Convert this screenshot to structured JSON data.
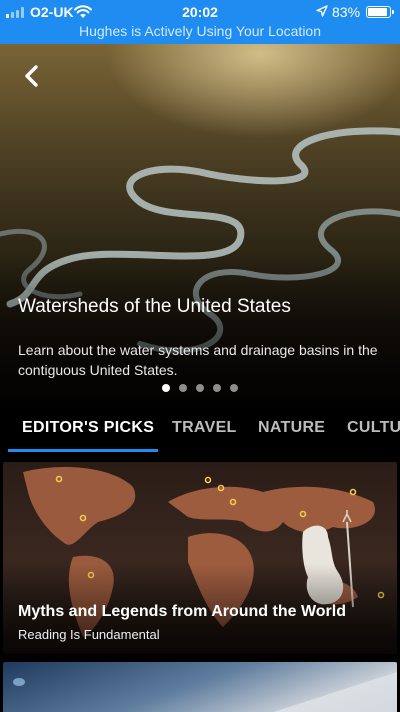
{
  "status_bar": {
    "carrier": "O2-UK",
    "time": "20:02",
    "battery": "83%",
    "battery_level": 0.83,
    "location_banner": "Hughes is Actively Using Your Location",
    "accent_color": "#1e8cf0"
  },
  "hero": {
    "title": "Watersheds of the United States",
    "description": "Learn about the water systems and drainage basins in the contiguous United States.",
    "page_count": 5,
    "active_page": 0,
    "back_icon": "chevron-left-icon"
  },
  "tabs": [
    {
      "label": "EDITOR'S PICKS",
      "active": true
    },
    {
      "label": "TRAVEL",
      "active": false
    },
    {
      "label": "NATURE",
      "active": false
    },
    {
      "label": "CULTU",
      "active": false
    }
  ],
  "cards": [
    {
      "title": "Myths and Legends from Around the World",
      "subtitle": "Reading Is Fundamental"
    }
  ]
}
